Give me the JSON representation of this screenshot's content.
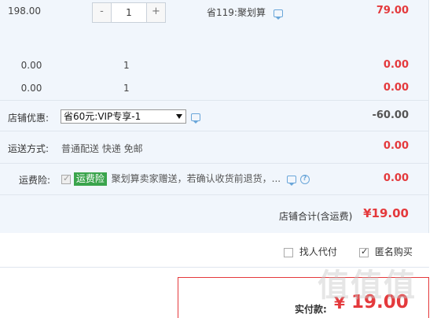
{
  "item_row": {
    "unit_price": "198.00",
    "quantity": "1",
    "minus_label": "-",
    "plus_label": "+",
    "discount_note": "省119:聚划算",
    "subtotal": "79.00"
  },
  "extra_rows": [
    {
      "price": "0.00",
      "quantity": "1",
      "subtotal": "0.00"
    },
    {
      "price": "0.00",
      "quantity": "1",
      "subtotal": "0.00"
    }
  ],
  "store_discount": {
    "label": "店铺优惠:",
    "selected_option": "省60元:VIP专享-1",
    "amount": "-60.00"
  },
  "shipping": {
    "label": "运送方式:",
    "method": "普通配送 快递 免邮",
    "amount": "0.00"
  },
  "shipping_insurance": {
    "label": "运费险:",
    "badge": "运费险",
    "description": "聚划算卖家赠送，若确认收货前退货，...",
    "amount": "0.00"
  },
  "store_total": {
    "label": "店铺合计(含运费)",
    "value": "¥19.00"
  },
  "options": {
    "proxy_pay": "找人代付",
    "anonymous": "匿名购买",
    "anonymous_checked": true,
    "proxy_checked": false
  },
  "final": {
    "label": "实付款:",
    "currency": "¥",
    "amount": "19.00"
  },
  "watermark": "值值值",
  "colors": {
    "accent_red": "#e4393c",
    "panel_bg": "#f1f6fc",
    "badge_green": "#3aa44c",
    "link_blue": "#6aa6d9"
  }
}
